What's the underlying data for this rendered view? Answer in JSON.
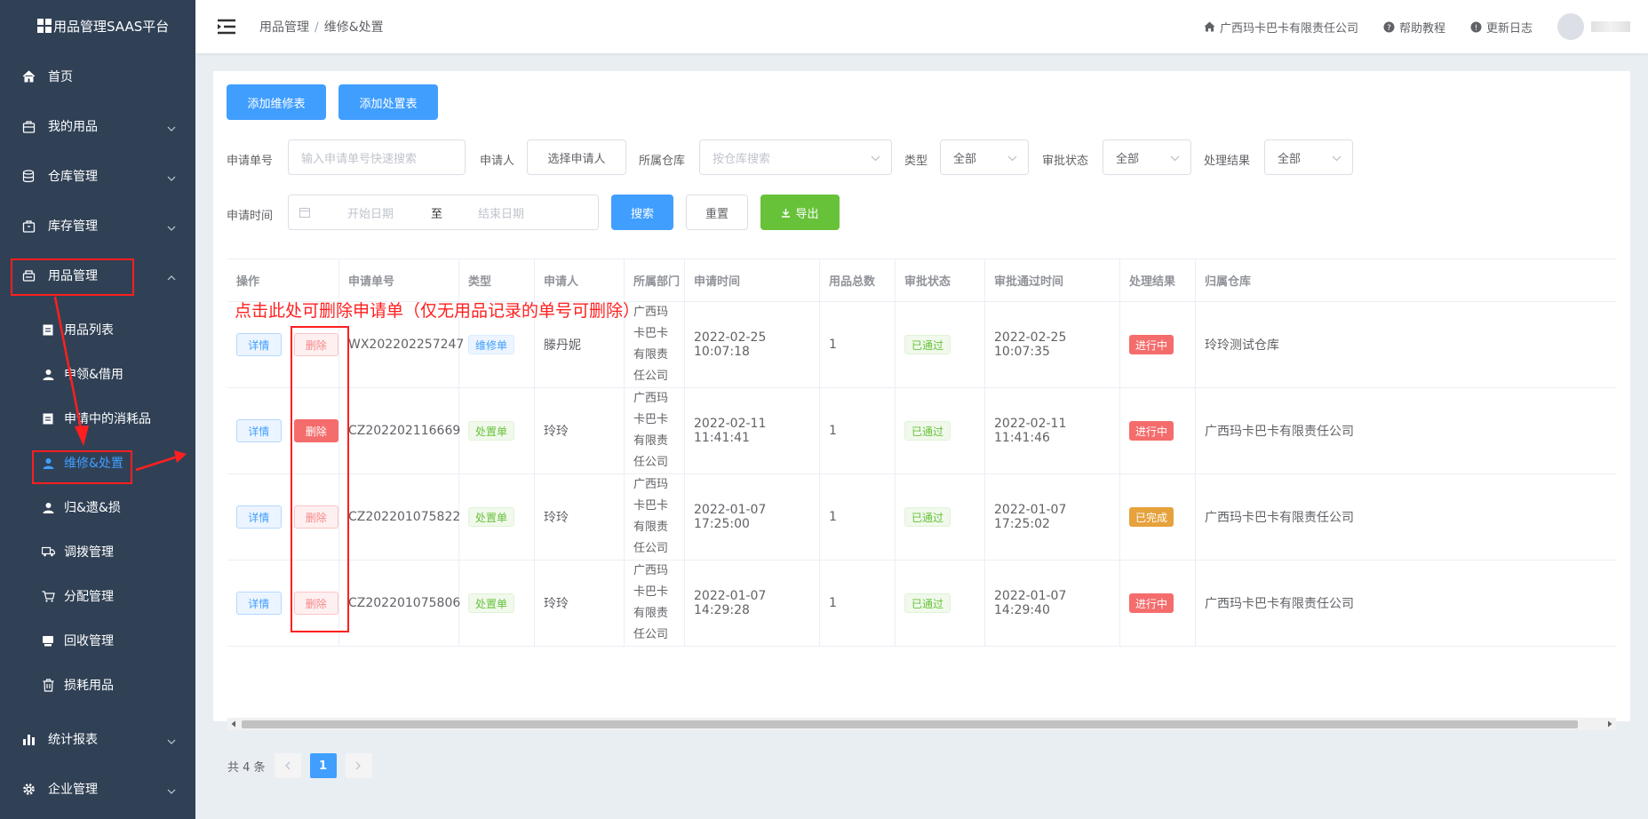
{
  "sidebar": {
    "logo": "用品管理SAAS平台",
    "items": [
      {
        "label": "首页",
        "icon": "home-icon"
      },
      {
        "label": "我的用品",
        "icon": "bag-icon"
      },
      {
        "label": "仓库管理",
        "icon": "database-icon"
      },
      {
        "label": "库存管理",
        "icon": "box-icon"
      },
      {
        "label": "用品管理",
        "icon": "printer-icon"
      }
    ],
    "submenu": [
      {
        "label": "用品列表",
        "icon": "clipboard-icon"
      },
      {
        "label": "申领&借用",
        "icon": "user-icon"
      },
      {
        "label": "申请中的消耗品",
        "icon": "clipboard-icon"
      },
      {
        "label": "维修&处置",
        "icon": "user-icon"
      },
      {
        "label": "归&遗&损",
        "icon": "user-icon"
      },
      {
        "label": "调拨管理",
        "icon": "truck-icon"
      },
      {
        "label": "分配管理",
        "icon": "cart-icon"
      },
      {
        "label": "回收管理",
        "icon": "recycle-icon"
      },
      {
        "label": "损耗用品",
        "icon": "trash-icon"
      }
    ],
    "bottom_items": [
      {
        "label": "统计报表",
        "icon": "bar-chart-icon"
      },
      {
        "label": "企业管理",
        "icon": "gear-icon"
      }
    ]
  },
  "header": {
    "breadcrumb": [
      "用品管理",
      "维修&处置"
    ],
    "company": "广西玛卡巴卡有限责任公司",
    "help": "帮助教程",
    "changelog": "更新日志"
  },
  "toolbar": {
    "add_repair": "添加维修表",
    "add_dispose": "添加处置表"
  },
  "filters": {
    "app_no_label": "申请单号",
    "app_no_placeholder": "输入申请单号快速搜索",
    "applicant_label": "申请人",
    "applicant_button": "选择申请人",
    "warehouse_label": "所属仓库",
    "warehouse_placeholder": "按仓库搜索",
    "type_label": "类型",
    "type_value": "全部",
    "approval_label": "审批状态",
    "approval_value": "全部",
    "result_label": "处理结果",
    "result_value": "全部",
    "time_label": "申请时间",
    "start_placeholder": "开始日期",
    "range_sep": "至",
    "end_placeholder": "结束日期",
    "search": "搜索",
    "reset": "重置",
    "export": "导出"
  },
  "table": {
    "columns": [
      "操作",
      "申请单号",
      "类型",
      "申请人",
      "所属部门",
      "申请时间",
      "用品总数",
      "审批状态",
      "审批通过时间",
      "处理结果",
      "归属仓库"
    ],
    "detail_label": "详情",
    "delete_label": "删除",
    "rows": [
      {
        "no": "WX202202257247",
        "type": "维修单",
        "applicant": "滕丹妮",
        "dept": "广西玛卡巴卡有限责任公司",
        "time": "2022-02-25 10:07:18",
        "count": "1",
        "approval": "已通过",
        "approved_time": "2022-02-25 10:07:35",
        "result": "进行中",
        "warehouse": "玲玲测试仓库"
      },
      {
        "no": "CZ202202116669",
        "type": "处置单",
        "applicant": "玲玲",
        "dept": "广西玛卡巴卡有限责任公司",
        "time": "2022-02-11 11:41:41",
        "count": "1",
        "approval": "已通过",
        "approved_time": "2022-02-11 11:41:46",
        "result": "进行中",
        "warehouse": "广西玛卡巴卡有限责任公司"
      },
      {
        "no": "CZ202201075822",
        "type": "处置单",
        "applicant": "玲玲",
        "dept": "广西玛卡巴卡有限责任公司",
        "time": "2022-01-07 17:25:00",
        "count": "1",
        "approval": "已通过",
        "approved_time": "2022-01-07 17:25:02",
        "result": "已完成",
        "warehouse": "广西玛卡巴卡有限责任公司"
      },
      {
        "no": "CZ202201075806",
        "type": "处置单",
        "applicant": "玲玲",
        "dept": "广西玛卡巴卡有限责任公司",
        "time": "2022-01-07 14:29:28",
        "count": "1",
        "approval": "已通过",
        "approved_time": "2022-01-07 14:29:40",
        "result": "进行中",
        "warehouse": "广西玛卡巴卡有限责任公司"
      }
    ]
  },
  "pagination": {
    "total": "共 4 条",
    "current": "1"
  },
  "annotation": "点击此处可删除申请单（仅无用品记录的单号可删除）",
  "colors": {
    "sidebar_bg": "#304156",
    "primary": "#409eff",
    "danger": "#f56c6c",
    "success": "#67c23a",
    "warning": "#e6a23c",
    "annotation_red": "#ff1f1f"
  }
}
